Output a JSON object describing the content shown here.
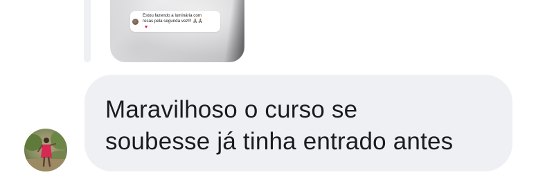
{
  "reply_preview": {
    "comment_text": "Estou fazendo a luminária com\nrosas pela segunda vez!!! 🙏🏽🙏🏽",
    "reaction_icon": "heart-icon",
    "reaction_glyph": "♥",
    "heart_color": "#d6193b"
  },
  "message": {
    "text": "Maravilhoso o curso se\nsoubesse já tinha entrado antes",
    "bubble_color": "#eff0f3",
    "text_color": "#1c1c1e"
  },
  "sender": {
    "avatar_icon": "avatar-photo"
  }
}
